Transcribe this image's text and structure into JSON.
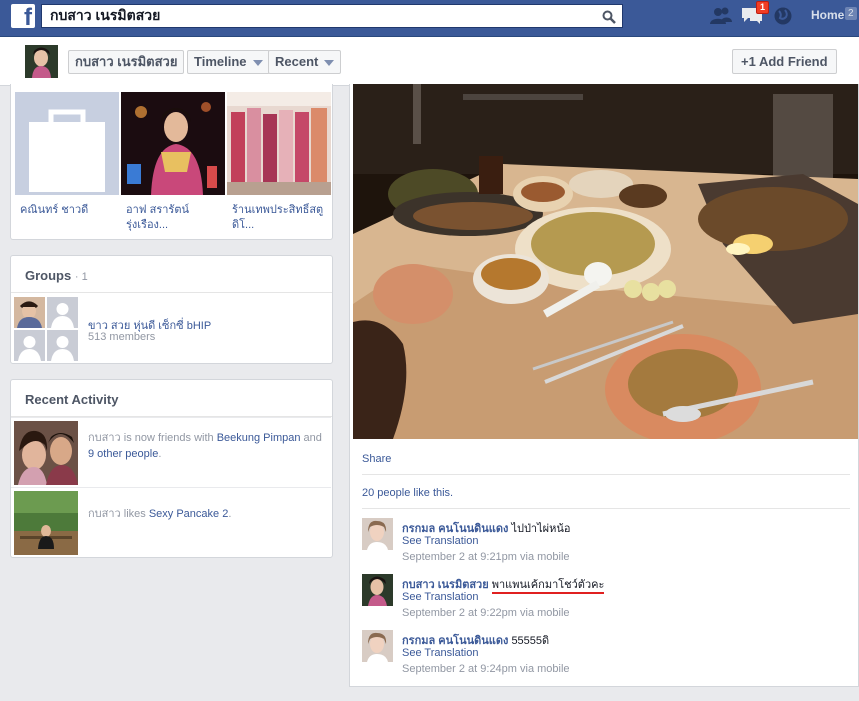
{
  "topbar": {
    "search_value": "กบสาว เนรมิตสวย",
    "notification_count": "1",
    "home_label": "Home",
    "home_count": "2"
  },
  "profile_bar": {
    "name_button": "กบสาว เนรมิตสวย",
    "timeline_button": "Timeline",
    "recent_button": "Recent",
    "add_friend_button": "+1 Add Friend"
  },
  "friends": [
    {
      "name": "คณินทร์ ชาวดี"
    },
    {
      "name": "อาฟ สรารัตน์ รุ่งเรือง..."
    },
    {
      "name": "ร้านเทพประสิทธิ์สตูดิโ..."
    }
  ],
  "groups": {
    "title": "Groups",
    "count": "· 1",
    "name": "ขาว สวย หุ่นดี เซ็กซี่ bHIP",
    "members": "513 members"
  },
  "recent_activity": {
    "title": "Recent Activity",
    "items": [
      {
        "pre": "กบสาว is now friends with ",
        "link1": "Beekung Pimpan",
        "mid": " and ",
        "link2": "9 other people",
        "post": "."
      },
      {
        "pre": "กบสาว likes ",
        "link1": "Sexy Pancake 2",
        "post": "."
      }
    ]
  },
  "post": {
    "share_label": "Share",
    "likes_text": "20 people like this.",
    "comments": [
      {
        "author": "กรกมล คนโนนดินแดง",
        "text": "ไปป่าไผ่หน้อ",
        "translate": "See Translation",
        "time": "September 2 at 9:21pm via mobile"
      },
      {
        "author": "กบสาว เนรมิตสวย",
        "text": "พาแพนเค้กมาโชว์ตัวคะ",
        "translate": "See Translation",
        "time": "September 2 at 9:22pm via mobile"
      },
      {
        "author": "กรกมล คนโนนดินแดง",
        "text": "55555ดิ",
        "translate": "See Translation",
        "time": "September 2 at 9:24pm via mobile"
      }
    ]
  }
}
